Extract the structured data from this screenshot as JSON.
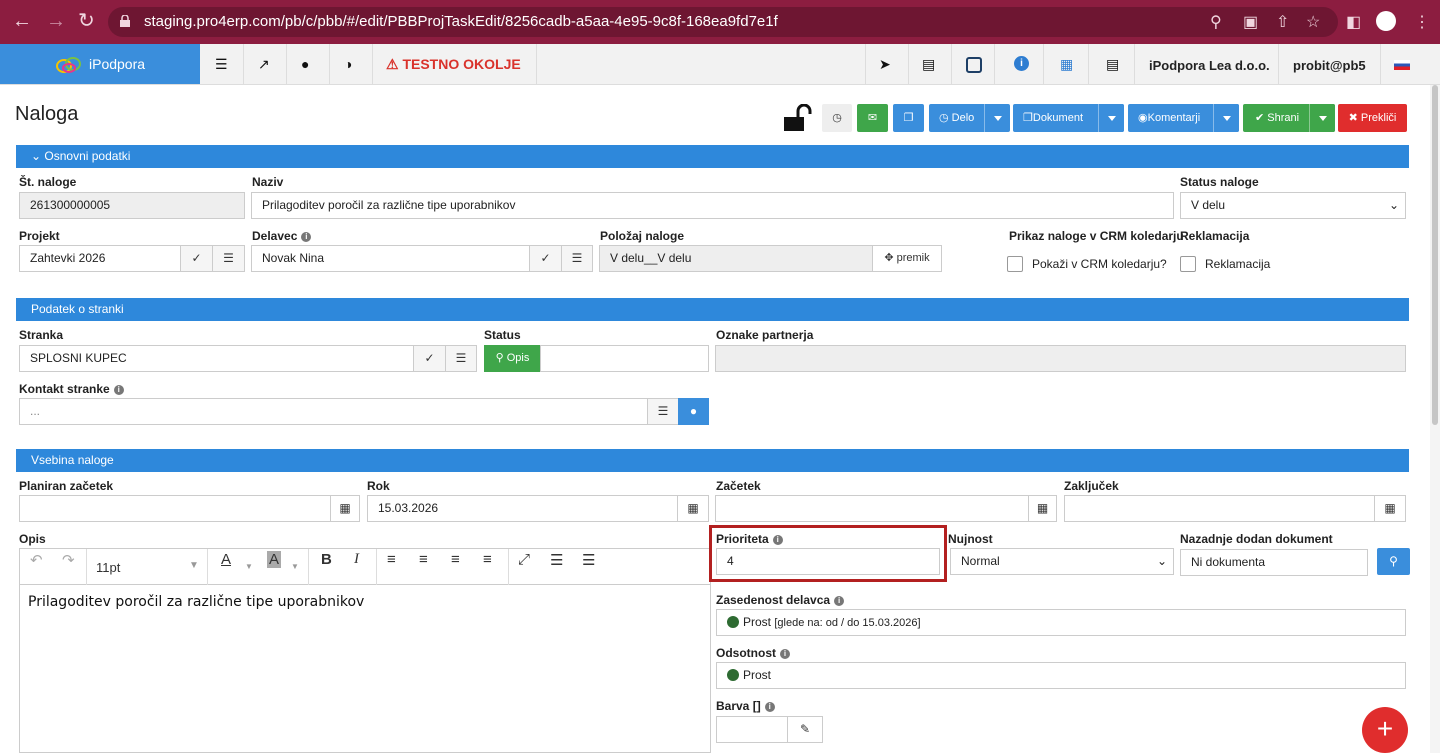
{
  "browser": {
    "url": "staging.pro4erp.com/pb/c/pbb/#/edit/PBBProjTaskEdit/8256cadb-a5aa-4e95-9c8f-168ea9fd7e1f"
  },
  "header": {
    "brand": "iPodpora",
    "env_warning": "TESTNO OKOLJE",
    "company": "iPodpora Lea d.o.o.",
    "user": "probit@pb5"
  },
  "page": {
    "title": "Naloga"
  },
  "toolbar": {
    "delo": "Delo",
    "dokument": "Dokument",
    "komentarji": "Komentarji",
    "shrani": "Shrani",
    "preklici": "Prekliči"
  },
  "sections": {
    "osnovni": "Osnovni podatki",
    "stranka": "Podatek o stranki",
    "vsebina": "Vsebina naloge"
  },
  "osnovni": {
    "st_label": "Št. naloge",
    "st_value": "261300000005",
    "naziv_label": "Naziv",
    "naziv_value": "Prilagoditev poročil za različne tipe uporabnikov",
    "status_label": "Status naloge",
    "status_value": "V delu",
    "projekt_label": "Projekt",
    "projekt_value": "Zahtevki 2026",
    "delavec_label": "Delavec",
    "delavec_value": "Novak Nina",
    "polozaj_label": "Položaj naloge",
    "polozaj_value": "V delu__V delu",
    "premik": "premik",
    "crm_label": "Prikaz naloge v CRM koledarju",
    "crm_check": "Pokaži v CRM koledarju?",
    "reklamacija_label": "Reklamacija",
    "reklamacija_check": "Reklamacija"
  },
  "stranka": {
    "stranka_label": "Stranka",
    "stranka_value": "SPLOSNI KUPEC",
    "status_label": "Status",
    "opis_btn": "Opis",
    "oznake_label": "Oznake partnerja",
    "kontakt_label": "Kontakt stranke",
    "kontakt_placeholder": "..."
  },
  "vsebina": {
    "planiran_label": "Planiran začetek",
    "rok_label": "Rok",
    "rok_value": "15.03.2026",
    "zacetek_label": "Začetek",
    "zakljucek_label": "Zaključek",
    "opis_label": "Opis",
    "font_size": "11pt",
    "opis_text": "Prilagoditev poročil za različne tipe uporabnikov",
    "prioriteta_label": "Prioriteta",
    "prioriteta_value": "4",
    "nujnost_label": "Nujnost",
    "nujnost_value": "Normal",
    "dokument_label": "Nazadnje dodan dokument",
    "dokument_value": "Ni dokumenta",
    "zasedenost_label": "Zasedenost delavca",
    "zasedenost_status": "Prost",
    "zasedenost_note": "[glede na: od / do 15.03.2026]",
    "odsotnost_label": "Odsotnost",
    "odsotnost_status": "Prost",
    "barva_label": "Barva []"
  },
  "colors": {
    "primary": "#3a8edc",
    "section": "#2e88db",
    "success": "#3fa64a",
    "danger": "#e02d2d",
    "chrome": "#8c1d40",
    "status_dot": "#2e6b32"
  }
}
